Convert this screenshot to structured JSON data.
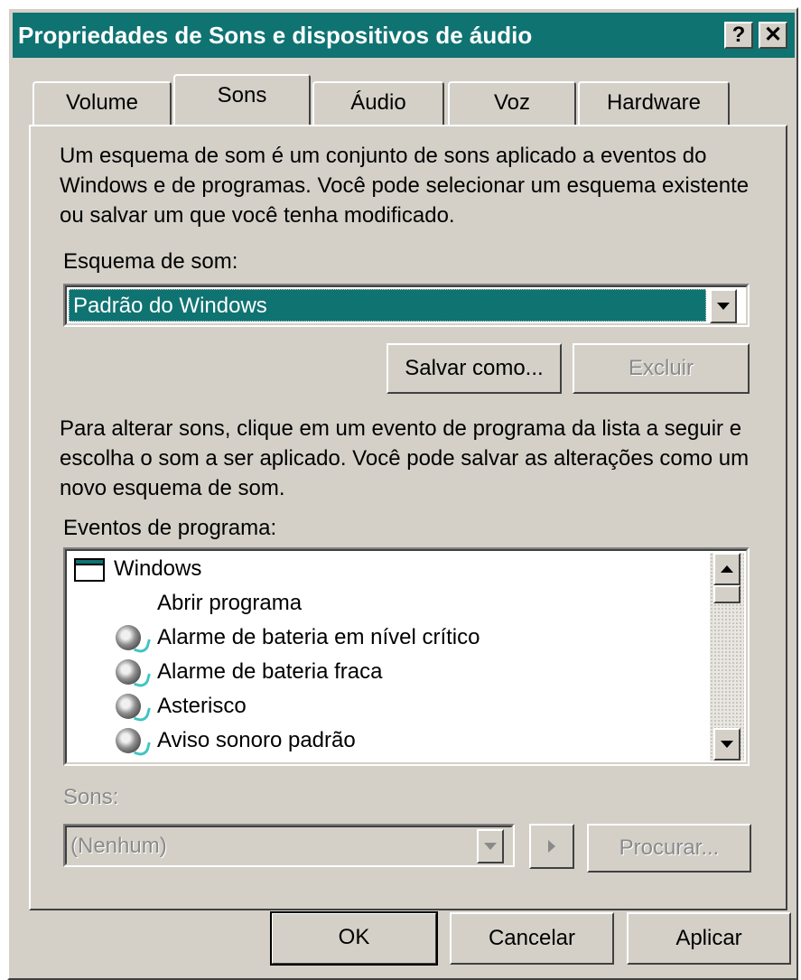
{
  "window": {
    "title": "Propriedades de Sons e dispositivos de áudio",
    "help_button": "?",
    "close_button": "✕"
  },
  "tabs": [
    {
      "label": "Volume",
      "active": false
    },
    {
      "label": "Sons",
      "active": true
    },
    {
      "label": "Áudio",
      "active": false
    },
    {
      "label": "Voz",
      "active": false
    },
    {
      "label": "Hardware",
      "active": false
    }
  ],
  "sons_tab": {
    "description_1": "Um esquema de som é um conjunto de sons aplicado a eventos do Windows e de programas. Você pode selecionar um esquema existente ou salvar um que você tenha modificado.",
    "scheme_label": "Esquema de som:",
    "scheme_selected": "Padrão do Windows",
    "save_as_button": "Salvar como...",
    "delete_button": "Excluir",
    "description_2": "Para alterar sons, clique em um evento de programa da lista a seguir e escolha o som a ser aplicado. Você pode salvar as alterações como um novo esquema de som.",
    "events_label": "Eventos de programa:",
    "events": [
      {
        "label": "Windows",
        "icon": "window-icon",
        "level": 0
      },
      {
        "label": "Abrir programa",
        "icon": "none",
        "level": 1
      },
      {
        "label": "Alarme de bateria em nível crítico",
        "icon": "speaker-icon",
        "level": 1
      },
      {
        "label": "Alarme de bateria fraca",
        "icon": "speaker-icon",
        "level": 1
      },
      {
        "label": "Asterisco",
        "icon": "speaker-icon",
        "level": 1
      },
      {
        "label": "Aviso sonoro padrão",
        "icon": "speaker-icon",
        "level": 1
      }
    ],
    "sounds_label": "Sons:",
    "sound_selected": "(Nenhum)",
    "browse_button": "Procurar..."
  },
  "footer": {
    "ok_button": "OK",
    "cancel_button": "Cancelar",
    "apply_button": "Aplicar"
  },
  "colors": {
    "titlebar": "#0f7372",
    "selection": "#0f7372",
    "face": "#d4d0c8",
    "disabled_text": "#8a8a8a"
  }
}
